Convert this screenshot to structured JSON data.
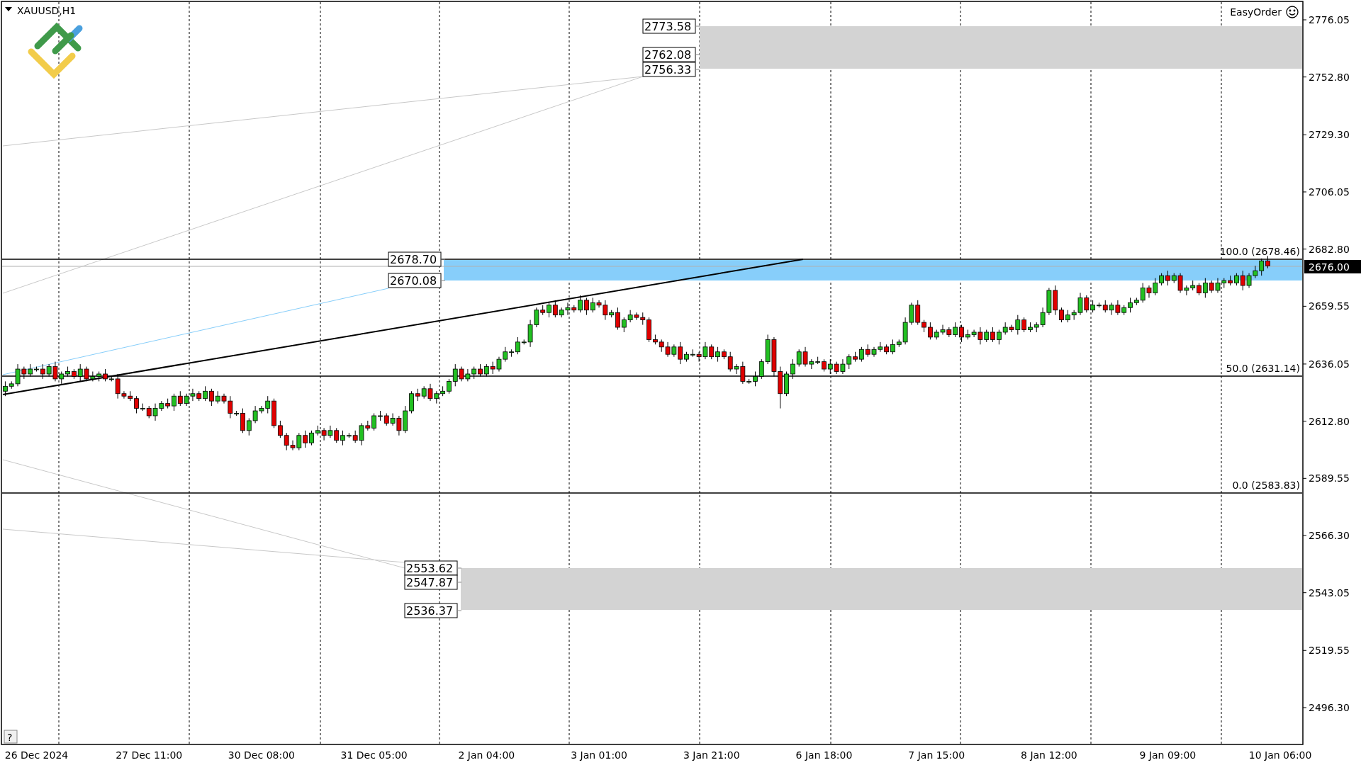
{
  "chart_window": {
    "symbol": "XAUUSD,H1",
    "indicator": "EasyOrder",
    "help_button": "?"
  },
  "zones": [
    {
      "labels": [
        "2773.58",
        "2762.08",
        "2756.33"
      ]
    },
    {
      "labels": [
        "2678.70",
        "2670.08"
      ]
    },
    {
      "labels": [
        "2553.62",
        "2547.87",
        "2536.37"
      ]
    }
  ],
  "fib_levels": [
    "100.0 (2678.46)",
    "50.0 (2631.14)",
    "0.0 (2583.83)"
  ],
  "current_price": "2676.00",
  "chart": {
    "chart_data": {
      "type": "candlestick",
      "ylim": [
        2481.6,
        2783.25
      ],
      "categories": [
        null,
        null,
        null,
        null,
        null,
        "26 Dec 2024",
        null,
        null,
        null,
        null,
        null,
        null,
        null,
        null,
        null,
        null,
        null,
        null,
        null,
        null,
        null,
        null,
        null,
        "27 Dec 11:00",
        null,
        null,
        null,
        null,
        null,
        null,
        null,
        null,
        null,
        null,
        null,
        null,
        null,
        null,
        null,
        null,
        null,
        "30 Dec 08:00",
        null,
        null,
        null,
        null,
        null,
        null,
        null,
        null,
        null,
        null,
        null,
        null,
        null,
        null,
        null,
        null,
        null,
        "31 Dec 05:00",
        null,
        null,
        null,
        null,
        null,
        null,
        null,
        null,
        null,
        null,
        null,
        null,
        null,
        null,
        null,
        null,
        null,
        "2 Jan 04:00",
        null,
        null,
        null,
        null,
        null,
        null,
        null,
        null,
        null,
        null,
        null,
        null,
        null,
        null,
        null,
        null,
        null,
        "3 Jan 01:00",
        null,
        null,
        null,
        null,
        null,
        null,
        null,
        null,
        null,
        null,
        null,
        null,
        null,
        null,
        null,
        null,
        null,
        "3 Jan 21:00",
        null,
        null,
        null,
        null,
        null,
        null,
        null,
        null,
        null,
        null,
        null,
        null,
        null,
        null,
        null,
        null,
        null,
        "6 Jan 18:00",
        null,
        null,
        null,
        null,
        null,
        null,
        null,
        null,
        null,
        null,
        null,
        null,
        null,
        null,
        null,
        null,
        null,
        "7 Jan 15:00",
        null,
        null,
        null,
        null,
        null,
        null,
        null,
        null,
        null,
        null,
        null,
        null,
        null,
        null,
        null,
        null,
        null,
        "8 Jan 12:00",
        null,
        null,
        null,
        null,
        null,
        null,
        null,
        null,
        null,
        null,
        null,
        null,
        null,
        null,
        null,
        null,
        null,
        null,
        "9 Jan 09:00",
        null,
        null,
        null,
        null,
        null,
        null,
        null,
        null,
        null,
        null,
        null,
        null,
        null,
        null,
        null,
        null,
        null,
        "10 Jan 06:00",
        null,
        null,
        null
      ],
      "yticks": [
        {
          "value": 2776.05,
          "label": "2776.05"
        },
        {
          "value": 2752.8,
          "label": "2752.80"
        },
        {
          "value": 2729.3,
          "label": "2729.30"
        },
        {
          "value": 2706.05,
          "label": "2706.05"
        },
        {
          "value": 2682.8,
          "label": "2682.80"
        },
        {
          "value": 2659.55,
          "label": "2659.55"
        },
        {
          "value": 2636.05,
          "label": "2636.05"
        },
        {
          "value": 2612.8,
          "label": "2612.80"
        },
        {
          "value": 2589.55,
          "label": "2589.55"
        },
        {
          "value": 2566.3,
          "label": "2566.30"
        },
        {
          "value": 2543.05,
          "label": "2543.05"
        },
        {
          "value": 2519.55,
          "label": "2519.55"
        },
        {
          "value": 2496.3,
          "label": "2496.30"
        }
      ],
      "ohlc": [
        [
          2625,
          2629,
          2623,
          2627
        ],
        [
          2627,
          2629,
          2626,
          2628
        ],
        [
          2628,
          2636,
          2627,
          2634
        ],
        [
          2634,
          2635,
          2630,
          2632
        ],
        [
          2632,
          2636,
          2631,
          2634
        ],
        [
          2634,
          2635,
          2633,
          2634
        ],
        [
          2634,
          2636,
          2630,
          2632
        ],
        [
          2632,
          2636,
          2631,
          2635
        ],
        [
          2635,
          2637,
          2629,
          2630
        ],
        [
          2630,
          2633,
          2628,
          2632
        ],
        [
          2632,
          2635,
          2631,
          2633
        ],
        [
          2633,
          2634,
          2630,
          2631
        ],
        [
          2631,
          2636,
          2629,
          2634
        ],
        [
          2634,
          2635,
          2629,
          2630
        ],
        [
          2630,
          2633,
          2629,
          2631
        ],
        [
          2631,
          2633,
          2629,
          2632
        ],
        [
          2632,
          2634,
          2629,
          2630
        ],
        [
          2630,
          2631,
          2629,
          2630
        ],
        [
          2630,
          2632,
          2622,
          2624
        ],
        [
          2624,
          2625,
          2622,
          2623
        ],
        [
          2623,
          2625,
          2621,
          2622
        ],
        [
          2622,
          2623,
          2616,
          2618
        ],
        [
          2618,
          2620,
          2617,
          2618
        ],
        [
          2618,
          2619,
          2614,
          2615
        ],
        [
          2615,
          2620,
          2613,
          2618
        ],
        [
          2618,
          2621,
          2617,
          2620
        ],
        [
          2620,
          2622,
          2618,
          2619
        ],
        [
          2619,
          2624,
          2617,
          2623
        ],
        [
          2623,
          2625,
          2619,
          2620
        ],
        [
          2620,
          2624,
          2619,
          2623
        ],
        [
          2623,
          2626,
          2621,
          2624
        ],
        [
          2624,
          2625,
          2621,
          2622
        ],
        [
          2622,
          2627,
          2621,
          2625
        ],
        [
          2625,
          2626,
          2619,
          2621
        ],
        [
          2621,
          2625,
          2620,
          2623
        ],
        [
          2623,
          2624,
          2620,
          2621
        ],
        [
          2621,
          2623,
          2614,
          2616
        ],
        [
          2616,
          2617,
          2615,
          2616
        ],
        [
          2616,
          2618,
          2608,
          2609
        ],
        [
          2609,
          2614,
          2607,
          2613
        ],
        [
          2613,
          2619,
          2612,
          2617
        ],
        [
          2617,
          2619,
          2616,
          2618
        ],
        [
          2618,
          2623,
          2616,
          2621
        ],
        [
          2621,
          2622,
          2610,
          2611
        ],
        [
          2611,
          2613,
          2606,
          2607
        ],
        [
          2607,
          2608,
          2601,
          2603
        ],
        [
          2603,
          2605,
          2601,
          2602
        ],
        [
          2602,
          2608,
          2601,
          2607
        ],
        [
          2607,
          2609,
          2602,
          2604
        ],
        [
          2604,
          2609,
          2603,
          2608
        ],
        [
          2608,
          2611,
          2607,
          2609
        ],
        [
          2609,
          2610,
          2605,
          2607
        ],
        [
          2607,
          2611,
          2606,
          2609
        ],
        [
          2609,
          2610,
          2604,
          2605
        ],
        [
          2605,
          2609,
          2603,
          2607
        ],
        [
          2607,
          2608,
          2606,
          2607
        ],
        [
          2607,
          2609,
          2604,
          2605
        ],
        [
          2605,
          2612,
          2603,
          2611
        ],
        [
          2611,
          2613,
          2609,
          2610
        ],
        [
          2610,
          2616,
          2609,
          2615
        ],
        [
          2615,
          2617,
          2613,
          2615
        ],
        [
          2615,
          2616,
          2611,
          2612
        ],
        [
          2612,
          2616,
          2611,
          2614
        ],
        [
          2614,
          2615,
          2607,
          2609
        ],
        [
          2609,
          2619,
          2608,
          2617
        ],
        [
          2617,
          2625,
          2616,
          2624
        ],
        [
          2624,
          2626,
          2621,
          2623
        ],
        [
          2623,
          2627,
          2622,
          2626
        ],
        [
          2626,
          2628,
          2621,
          2622
        ],
        [
          2622,
          2625,
          2620,
          2624
        ],
        [
          2624,
          2627,
          2623,
          2625
        ],
        [
          2625,
          2630,
          2624,
          2629
        ],
        [
          2629,
          2636,
          2627,
          2634
        ],
        [
          2634,
          2635,
          2629,
          2630
        ],
        [
          2630,
          2634,
          2629,
          2632
        ],
        [
          2632,
          2635,
          2630,
          2634
        ],
        [
          2634,
          2636,
          2631,
          2632
        ],
        [
          2632,
          2636,
          2631,
          2635
        ],
        [
          2635,
          2637,
          2632,
          2634
        ],
        [
          2634,
          2639,
          2633,
          2638
        ],
        [
          2638,
          2643,
          2637,
          2641
        ],
        [
          2641,
          2642,
          2639,
          2641
        ],
        [
          2641,
          2647,
          2640,
          2645
        ],
        [
          2645,
          2646,
          2644,
          2645
        ],
        [
          2645,
          2654,
          2643,
          2652
        ],
        [
          2652,
          2659,
          2651,
          2658
        ],
        [
          2658,
          2660,
          2656,
          2657
        ],
        [
          2657,
          2661,
          2655,
          2660
        ],
        [
          2660,
          2662,
          2655,
          2656
        ],
        [
          2656,
          2659,
          2655,
          2658
        ],
        [
          2658,
          2661,
          2656,
          2659
        ],
        [
          2659,
          2660,
          2657,
          2658
        ],
        [
          2658,
          2664,
          2657,
          2662
        ],
        [
          2662,
          2663,
          2656,
          2658
        ],
        [
          2658,
          2663,
          2657,
          2661
        ],
        [
          2661,
          2662,
          2659,
          2660
        ],
        [
          2660,
          2662,
          2654,
          2656
        ],
        [
          2656,
          2658,
          2655,
          2657
        ],
        [
          2657,
          2659,
          2650,
          2651
        ],
        [
          2651,
          2655,
          2649,
          2654
        ],
        [
          2654,
          2658,
          2653,
          2656
        ],
        [
          2656,
          2657,
          2654,
          2655
        ],
        [
          2655,
          2657,
          2652,
          2654
        ],
        [
          2654,
          2655,
          2645,
          2646
        ],
        [
          2646,
          2648,
          2644,
          2645
        ],
        [
          2645,
          2646,
          2641,
          2643
        ],
        [
          2643,
          2645,
          2639,
          2640
        ],
        [
          2640,
          2644,
          2639,
          2643
        ],
        [
          2643,
          2645,
          2636,
          2638
        ],
        [
          2638,
          2641,
          2637,
          2640
        ],
        [
          2640,
          2642,
          2639,
          2640
        ],
        [
          2640,
          2641,
          2637,
          2639
        ],
        [
          2639,
          2645,
          2638,
          2643
        ],
        [
          2643,
          2644,
          2638,
          2639
        ],
        [
          2639,
          2643,
          2637,
          2641
        ],
        [
          2641,
          2642,
          2638,
          2639
        ],
        [
          2639,
          2641,
          2633,
          2634
        ],
        [
          2634,
          2636,
          2632,
          2635
        ],
        [
          2635,
          2637,
          2628,
          2629
        ],
        [
          2629,
          2630,
          2628,
          2629
        ],
        [
          2629,
          2633,
          2627,
          2631
        ],
        [
          2631,
          2638,
          2630,
          2637
        ],
        [
          2637,
          2648,
          2636,
          2646
        ],
        [
          2646,
          2647,
          2631,
          2633
        ],
        [
          2633,
          2635,
          2618,
          2624
        ],
        [
          2624,
          2633,
          2623,
          2632
        ],
        [
          2632,
          2638,
          2630,
          2636
        ],
        [
          2636,
          2642,
          2635,
          2641
        ],
        [
          2641,
          2643,
          2635,
          2636
        ],
        [
          2636,
          2638,
          2634,
          2637
        ],
        [
          2637,
          2639,
          2636,
          2637
        ],
        [
          2637,
          2638,
          2633,
          2634
        ],
        [
          2634,
          2638,
          2632,
          2636
        ],
        [
          2636,
          2637,
          2632,
          2633
        ],
        [
          2633,
          2638,
          2632,
          2636
        ],
        [
          2636,
          2640,
          2634,
          2639
        ],
        [
          2639,
          2641,
          2637,
          2638
        ],
        [
          2638,
          2643,
          2637,
          2642
        ],
        [
          2642,
          2644,
          2639,
          2640
        ],
        [
          2640,
          2643,
          2639,
          2642
        ],
        [
          2642,
          2645,
          2641,
          2643
        ],
        [
          2643,
          2644,
          2640,
          2641
        ],
        [
          2641,
          2646,
          2640,
          2644
        ],
        [
          2644,
          2646,
          2643,
          2645
        ],
        [
          2645,
          2655,
          2644,
          2653
        ],
        [
          2653,
          2661,
          2652,
          2660
        ],
        [
          2660,
          2662,
          2652,
          2653
        ],
        [
          2653,
          2654,
          2649,
          2651
        ],
        [
          2651,
          2653,
          2646,
          2647
        ],
        [
          2647,
          2650,
          2646,
          2649
        ],
        [
          2649,
          2652,
          2648,
          2650
        ],
        [
          2650,
          2651,
          2647,
          2648
        ],
        [
          2648,
          2653,
          2647,
          2651
        ],
        [
          2651,
          2652,
          2645,
          2647
        ],
        [
          2647,
          2650,
          2646,
          2648
        ],
        [
          2648,
          2650,
          2647,
          2649
        ],
        [
          2649,
          2651,
          2644,
          2646
        ],
        [
          2646,
          2650,
          2645,
          2649
        ],
        [
          2649,
          2651,
          2645,
          2646
        ],
        [
          2646,
          2650,
          2644,
          2649
        ],
        [
          2649,
          2653,
          2648,
          2651
        ],
        [
          2651,
          2652,
          2649,
          2650
        ],
        [
          2650,
          2656,
          2648,
          2654
        ],
        [
          2654,
          2655,
          2649,
          2650
        ],
        [
          2650,
          2653,
          2649,
          2651
        ],
        [
          2651,
          2653,
          2649,
          2652
        ],
        [
          2652,
          2659,
          2651,
          2657
        ],
        [
          2657,
          2667,
          2656,
          2666
        ],
        [
          2666,
          2668,
          2656,
          2658
        ],
        [
          2658,
          2659,
          2653,
          2654
        ],
        [
          2654,
          2658,
          2653,
          2656
        ],
        [
          2656,
          2658,
          2654,
          2657
        ],
        [
          2657,
          2665,
          2656,
          2663
        ],
        [
          2663,
          2664,
          2657,
          2658
        ],
        [
          2658,
          2662,
          2657,
          2660
        ],
        [
          2660,
          2661,
          2659,
          2660
        ],
        [
          2660,
          2662,
          2657,
          2658
        ],
        [
          2658,
          2661,
          2656,
          2660
        ],
        [
          2660,
          2662,
          2656,
          2657
        ],
        [
          2657,
          2660,
          2656,
          2659
        ],
        [
          2659,
          2663,
          2657,
          2661
        ],
        [
          2661,
          2663,
          2660,
          2662
        ],
        [
          2662,
          2669,
          2661,
          2667
        ],
        [
          2667,
          2668,
          2663,
          2665
        ],
        [
          2665,
          2671,
          2664,
          2669
        ],
        [
          2669,
          2673,
          2668,
          2672
        ],
        [
          2672,
          2674,
          2668,
          2670
        ],
        [
          2670,
          2673,
          2669,
          2672
        ],
        [
          2672,
          2673,
          2665,
          2666
        ],
        [
          2666,
          2668,
          2664,
          2667
        ],
        [
          2667,
          2670,
          2666,
          2668
        ],
        [
          2668,
          2669,
          2664,
          2665
        ],
        [
          2665,
          2671,
          2663,
          2669
        ],
        [
          2669,
          2670,
          2665,
          2666
        ],
        [
          2666,
          2671,
          2665,
          2669
        ],
        [
          2669,
          2671,
          2667,
          2670
        ],
        [
          2670,
          2672,
          2668,
          2669
        ],
        [
          2669,
          2673,
          2668,
          2672
        ],
        [
          2672,
          2674,
          2666,
          2668
        ],
        [
          2668,
          2673,
          2667,
          2672
        ],
        [
          2672,
          2676,
          2671,
          2674
        ],
        [
          2674,
          2679,
          2672,
          2678
        ],
        [
          2678,
          2680,
          2675,
          2676
        ],
        null,
        null,
        null,
        null,
        null
      ]
    }
  }
}
